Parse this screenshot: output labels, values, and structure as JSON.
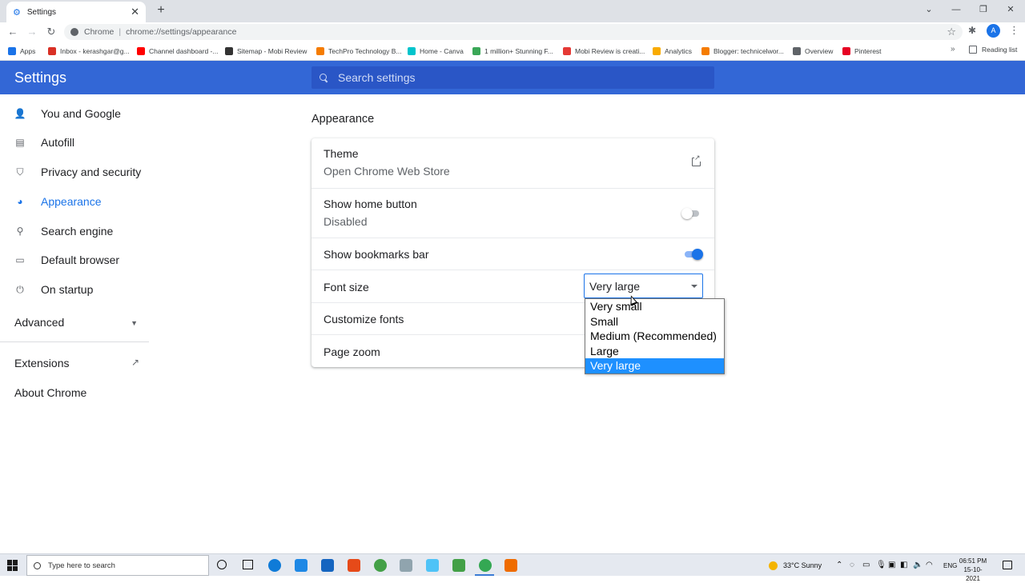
{
  "browser": {
    "tab_title": "Settings",
    "tab_close": "✕",
    "new_tab": "+",
    "omnibox_origin": "Chrome",
    "omnibox_separator": "|",
    "omnibox_url": "chrome://settings/appearance",
    "profile_initial": "A",
    "bookmarks": [
      {
        "label": "Apps",
        "color": "#1a73e8"
      },
      {
        "label": "Inbox - kerashgar@g...",
        "color": "#d93025"
      },
      {
        "label": "Channel dashboard -...",
        "color": "#ff0000"
      },
      {
        "label": "Sitemap - Mobi Review",
        "color": "#333333"
      },
      {
        "label": "TechPro Technology B...",
        "color": "#f57c00"
      },
      {
        "label": "Home - Canva",
        "color": "#00c4cc"
      },
      {
        "label": "1 million+ Stunning F...",
        "color": "#3aa757"
      },
      {
        "label": "Mobi Review is creati...",
        "color": "#e53935"
      },
      {
        "label": "Analytics",
        "color": "#f9ab00"
      },
      {
        "label": "Blogger: technicelwor...",
        "color": "#f57c00"
      },
      {
        "label": "Overview",
        "color": "#5f6368"
      },
      {
        "label": "Pinterest",
        "color": "#e60023"
      }
    ],
    "bookmarks_more": "»",
    "reading_list": "Reading list"
  },
  "settings": {
    "title": "Settings",
    "search_placeholder": "Search settings",
    "sidebar": [
      {
        "label": "You and Google",
        "icon": "person-icon",
        "active": false
      },
      {
        "label": "Autofill",
        "icon": "clipboard-icon",
        "active": false
      },
      {
        "label": "Privacy and security",
        "icon": "shield-icon",
        "active": false
      },
      {
        "label": "Appearance",
        "icon": "palette-icon",
        "active": true
      },
      {
        "label": "Search engine",
        "icon": "search-icon",
        "active": false
      },
      {
        "label": "Default browser",
        "icon": "browser-icon",
        "active": false
      },
      {
        "label": "On startup",
        "icon": "power-icon",
        "active": false
      }
    ],
    "advanced": "Advanced",
    "extensions": "Extensions",
    "about": "About Chrome",
    "colors": {
      "header": "#3367d6",
      "accent": "#1a73e8"
    }
  },
  "appearance": {
    "section_title": "Appearance",
    "theme_label": "Theme",
    "theme_sub": "Open Chrome Web Store",
    "home_button_label": "Show home button",
    "home_button_sub": "Disabled",
    "home_button_on": false,
    "bookmarks_bar_label": "Show bookmarks bar",
    "bookmarks_bar_on": true,
    "font_size_label": "Font size",
    "font_size_value": "Very large",
    "font_size_options": [
      "Very small",
      "Small",
      "Medium (Recommended)",
      "Large",
      "Very large"
    ],
    "font_size_selected_index": 4,
    "customize_fonts_label": "Customize fonts",
    "page_zoom_label": "Page zoom"
  },
  "taskbar": {
    "search_placeholder": "Type here to search",
    "weather": "33°C  Sunny",
    "language": "ENG",
    "time": "06:51 PM",
    "date": "15-10-2021"
  }
}
